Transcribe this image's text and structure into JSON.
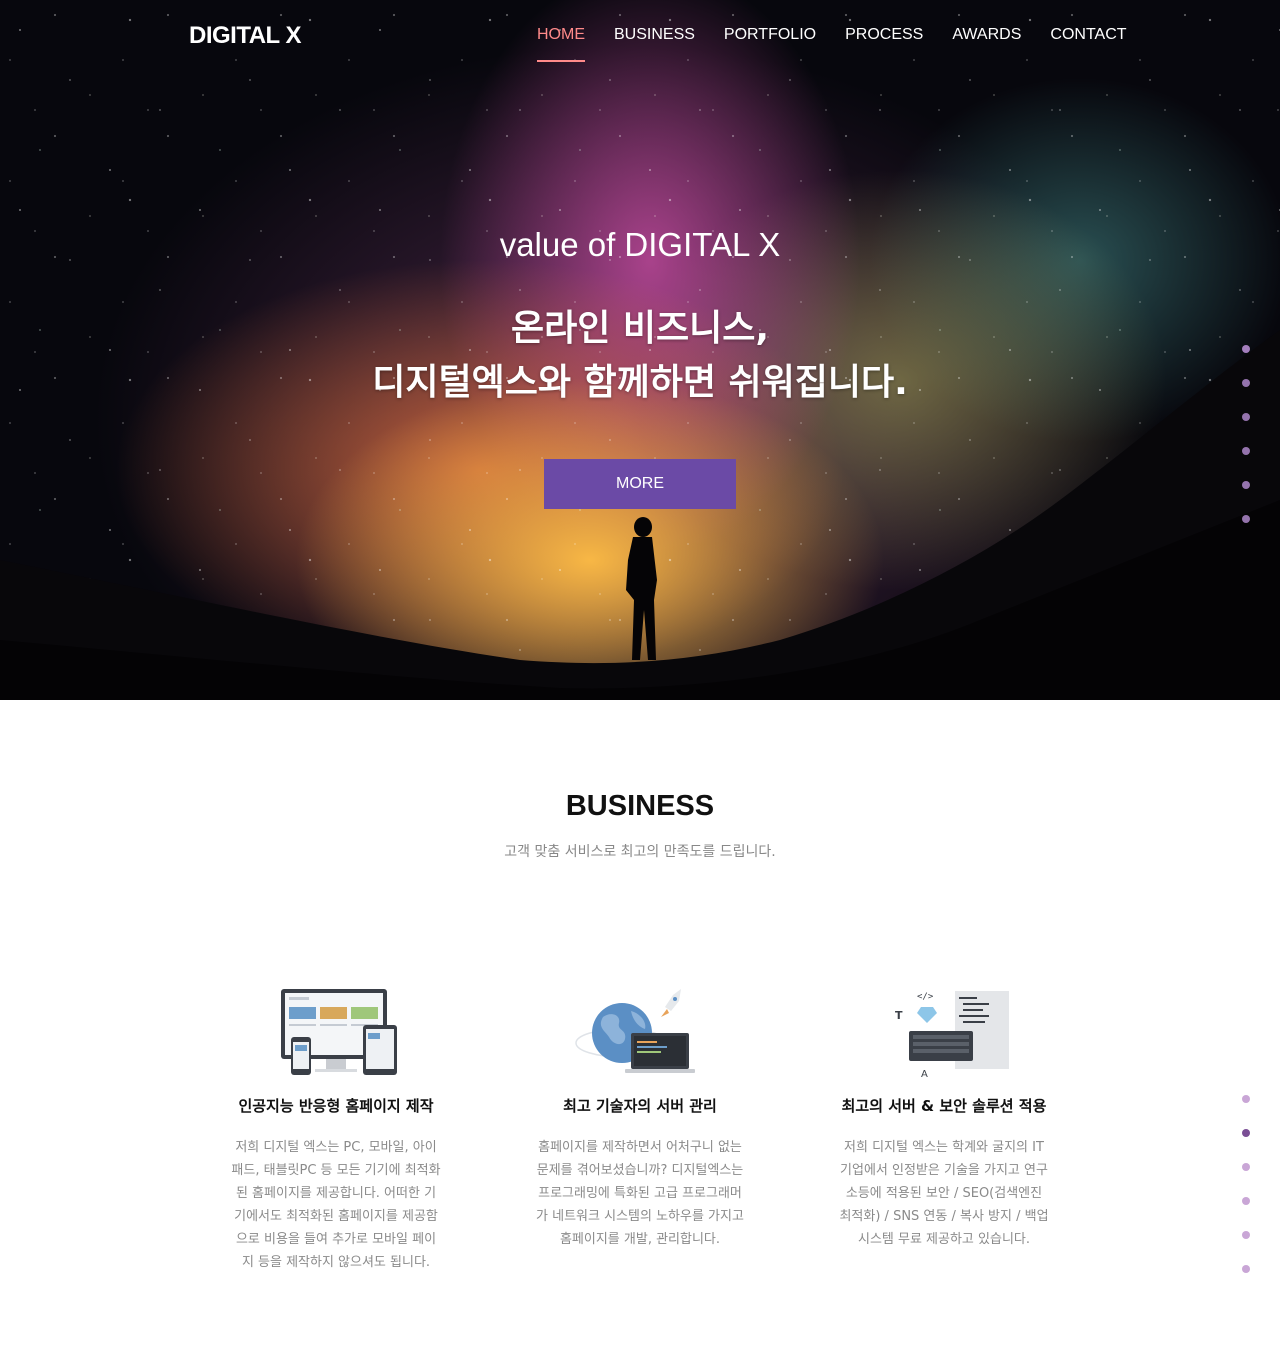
{
  "header": {
    "logo": "DIGITAL X",
    "nav": [
      "HOME",
      "BUSINESS",
      "PORTFOLIO",
      "PROCESS",
      "AWARDS",
      "CONTACT"
    ],
    "active": "HOME"
  },
  "hero": {
    "subtitle": "value of DIGITAL X",
    "title_line1": "온라인 비즈니스,",
    "title_line2": "디지털엑스와 함께하면 쉬워집니다.",
    "button": "MORE"
  },
  "business": {
    "title": "BUSINESS",
    "subtitle": "고객 맞춤 서비스로 최고의 만족도를 드립니다.",
    "cards": [
      {
        "icon": "responsive-devices-icon",
        "title": "인공지능 반응형 홈페이지 제작",
        "text": "저희 디지털 엑스는 PC, 모바일, 아이\n패드, 태블릿PC 등 모든 기기에 최적화\n된 홈페이지를 제공합니다. 어떠한 기\n기에서도 최적화된 홈페이지를 제공함\n으로 비용을 들여 추가로 모바일 페이\n지 등을 제작하지 않으셔도 됩니다."
      },
      {
        "icon": "globe-rocket-laptop-icon",
        "title": "최고 기술자의 서버 관리",
        "text": "홈페이지를 제작하면서 어처구니 없는\n문제를 겪어보셨습니까? 디지털엑스는\n프로그래밍에 특화된 고급 프로그래머\n가 네트워크 시스템의 노하우를 가지고\n홈페이지를 개발, 관리합니다."
      },
      {
        "icon": "code-security-keyboard-icon",
        "title": "최고의 서버 & 보안 솔루션 적용",
        "text": "저희 디지털 엑스는 학계와 굴지의 IT\n기업에서 인정받은 기술을 가지고 연구\n소등에 적용된 보안 / SEO(검색엔진\n최적화) / SNS 연동 / 복사 방지 / 백업\n시스템 무료 제공하고 있습니다."
      }
    ]
  },
  "colors": {
    "accent": "#6b4aa6",
    "nav_active": "#ff8a8a",
    "dot": "#c9a6d6",
    "dot_active": "#7a4e95"
  }
}
